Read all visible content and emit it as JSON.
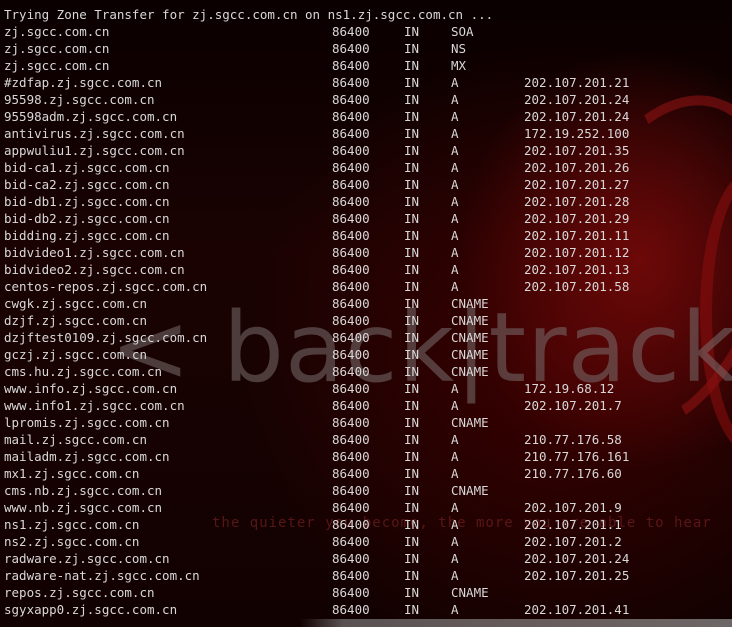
{
  "terminal": {
    "header": "Trying Zone Transfer for zj.sgcc.com.cn on ns1.zj.sgcc.com.cn ...",
    "wallpaper": {
      "brand": "< back|track",
      "tagline": "the quieter you become, the more you are able to hear"
    },
    "colors": {
      "text": "#d8d8d8",
      "background": "#120101",
      "accent": "#8a0a0a"
    },
    "records": [
      {
        "host": "zj.sgcc.com.cn",
        "ttl": "86400",
        "class": "IN",
        "type": "SOA",
        "data": ""
      },
      {
        "host": "zj.sgcc.com.cn",
        "ttl": "86400",
        "class": "IN",
        "type": "NS",
        "data": ""
      },
      {
        "host": "zj.sgcc.com.cn",
        "ttl": "86400",
        "class": "IN",
        "type": "MX",
        "data": ""
      },
      {
        "host": "#zdfap.zj.sgcc.com.cn",
        "ttl": "86400",
        "class": "IN",
        "type": "A",
        "data": "202.107.201.21"
      },
      {
        "host": "95598.zj.sgcc.com.cn",
        "ttl": "86400",
        "class": "IN",
        "type": "A",
        "data": "202.107.201.24"
      },
      {
        "host": "95598adm.zj.sgcc.com.cn",
        "ttl": "86400",
        "class": "IN",
        "type": "A",
        "data": "202.107.201.24"
      },
      {
        "host": "antivirus.zj.sgcc.com.cn",
        "ttl": "86400",
        "class": "IN",
        "type": "A",
        "data": "172.19.252.100"
      },
      {
        "host": "appwuliu1.zj.sgcc.com.cn",
        "ttl": "86400",
        "class": "IN",
        "type": "A",
        "data": "202.107.201.35"
      },
      {
        "host": "bid-ca1.zj.sgcc.com.cn",
        "ttl": "86400",
        "class": "IN",
        "type": "A",
        "data": "202.107.201.26"
      },
      {
        "host": "bid-ca2.zj.sgcc.com.cn",
        "ttl": "86400",
        "class": "IN",
        "type": "A",
        "data": "202.107.201.27"
      },
      {
        "host": "bid-db1.zj.sgcc.com.cn",
        "ttl": "86400",
        "class": "IN",
        "type": "A",
        "data": "202.107.201.28"
      },
      {
        "host": "bid-db2.zj.sgcc.com.cn",
        "ttl": "86400",
        "class": "IN",
        "type": "A",
        "data": "202.107.201.29"
      },
      {
        "host": "bidding.zj.sgcc.com.cn",
        "ttl": "86400",
        "class": "IN",
        "type": "A",
        "data": "202.107.201.11"
      },
      {
        "host": "bidvideo1.zj.sgcc.com.cn",
        "ttl": "86400",
        "class": "IN",
        "type": "A",
        "data": "202.107.201.12"
      },
      {
        "host": "bidvideo2.zj.sgcc.com.cn",
        "ttl": "86400",
        "class": "IN",
        "type": "A",
        "data": "202.107.201.13"
      },
      {
        "host": "centos-repos.zj.sgcc.com.cn",
        "ttl": "86400",
        "class": "IN",
        "type": "A",
        "data": "202.107.201.58"
      },
      {
        "host": "cwgk.zj.sgcc.com.cn",
        "ttl": "86400",
        "class": "IN",
        "type": "CNAME",
        "data": ""
      },
      {
        "host": "dzjf.zj.sgcc.com.cn",
        "ttl": "86400",
        "class": "IN",
        "type": "CNAME",
        "data": ""
      },
      {
        "host": "dzjftest0109.zj.sgcc.com.cn",
        "ttl": "86400",
        "class": "IN",
        "type": "CNAME",
        "data": ""
      },
      {
        "host": "gczj.zj.sgcc.com.cn",
        "ttl": "86400",
        "class": "IN",
        "type": "CNAME",
        "data": ""
      },
      {
        "host": "cms.hu.zj.sgcc.com.cn",
        "ttl": "86400",
        "class": "IN",
        "type": "CNAME",
        "data": ""
      },
      {
        "host": "www.info.zj.sgcc.com.cn",
        "ttl": "86400",
        "class": "IN",
        "type": "A",
        "data": "172.19.68.12"
      },
      {
        "host": "www.info1.zj.sgcc.com.cn",
        "ttl": "86400",
        "class": "IN",
        "type": "A",
        "data": "202.107.201.7"
      },
      {
        "host": "lpromis.zj.sgcc.com.cn",
        "ttl": "86400",
        "class": "IN",
        "type": "CNAME",
        "data": ""
      },
      {
        "host": "mail.zj.sgcc.com.cn",
        "ttl": "86400",
        "class": "IN",
        "type": "A",
        "data": "210.77.176.58"
      },
      {
        "host": "mailadm.zj.sgcc.com.cn",
        "ttl": "86400",
        "class": "IN",
        "type": "A",
        "data": "210.77.176.161"
      },
      {
        "host": "mx1.zj.sgcc.com.cn",
        "ttl": "86400",
        "class": "IN",
        "type": "A",
        "data": "210.77.176.60"
      },
      {
        "host": "cms.nb.zj.sgcc.com.cn",
        "ttl": "86400",
        "class": "IN",
        "type": "CNAME",
        "data": ""
      },
      {
        "host": "www.nb.zj.sgcc.com.cn",
        "ttl": "86400",
        "class": "IN",
        "type": "A",
        "data": "202.107.201.9"
      },
      {
        "host": "ns1.zj.sgcc.com.cn",
        "ttl": "86400",
        "class": "IN",
        "type": "A",
        "data": "202.107.201.1"
      },
      {
        "host": "ns2.zj.sgcc.com.cn",
        "ttl": "86400",
        "class": "IN",
        "type": "A",
        "data": "202.107.201.2"
      },
      {
        "host": "radware.zj.sgcc.com.cn",
        "ttl": "86400",
        "class": "IN",
        "type": "A",
        "data": "202.107.201.24"
      },
      {
        "host": "radware-nat.zj.sgcc.com.cn",
        "ttl": "86400",
        "class": "IN",
        "type": "A",
        "data": "202.107.201.25"
      },
      {
        "host": "repos.zj.sgcc.com.cn",
        "ttl": "86400",
        "class": "IN",
        "type": "CNAME",
        "data": ""
      },
      {
        "host": "sgyxapp0.zj.sgcc.com.cn",
        "ttl": "86400",
        "class": "IN",
        "type": "A",
        "data": "202.107.201.41"
      }
    ]
  }
}
